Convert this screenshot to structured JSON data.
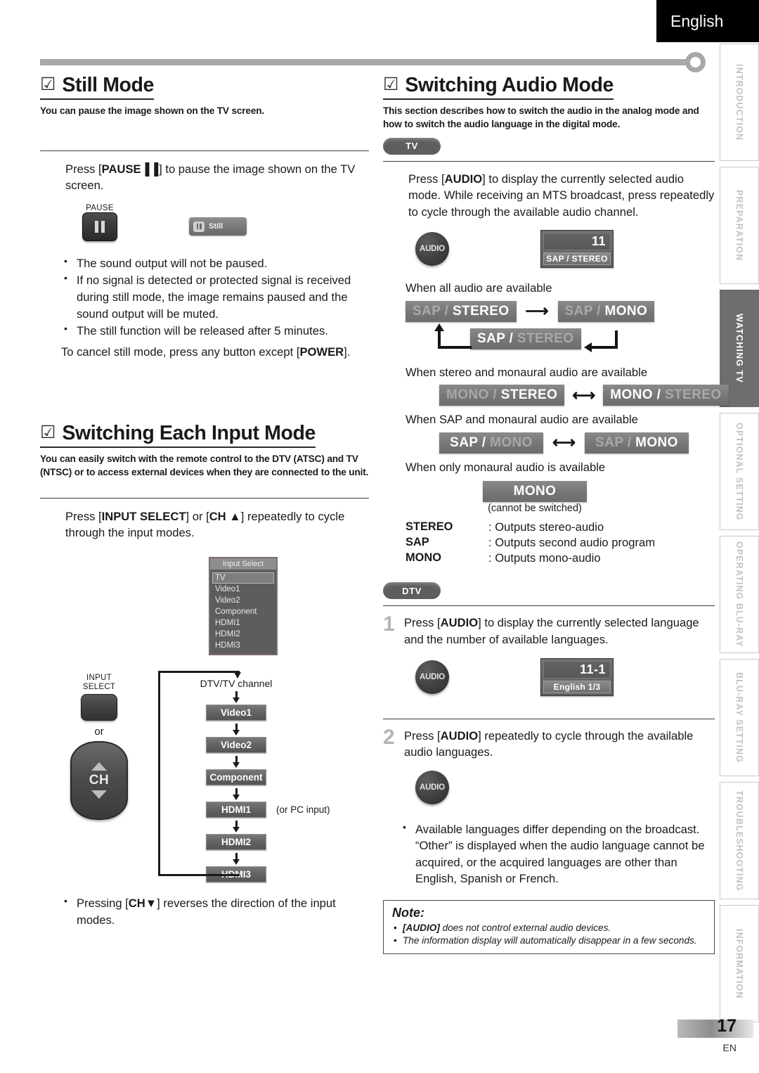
{
  "header": {
    "language": "English"
  },
  "side_tabs": [
    {
      "label": "INTRODUCTION",
      "active": false
    },
    {
      "label": "PREPARATION",
      "active": false
    },
    {
      "label": "WATCHING TV",
      "active": true
    },
    {
      "label": "OPTIONAL SETTING",
      "active": false
    },
    {
      "label": "OPERATING BLU-RAY",
      "active": false
    },
    {
      "label": "BLU-RAY SETTING",
      "active": false
    },
    {
      "label": "TROUBLESHOOTING",
      "active": false
    },
    {
      "label": "INFORMATION",
      "active": false
    }
  ],
  "still_mode": {
    "check": "☑",
    "heading": "Still Mode",
    "subtitle": "You can pause the image shown on the TV screen.",
    "instruction_pre": "Press [",
    "instruction_key": "PAUSE",
    "instruction_post": "] to pause the image shown on the TV screen.",
    "pause_caption": "PAUSE",
    "osd_still_label": "Still",
    "bullets": [
      "The sound output will not be paused.",
      "If no signal is detected or protected signal is received during still mode, the image remains paused and the sound output will be muted.",
      "The still function will be released after 5 minutes."
    ],
    "cancel_pre": "To cancel still mode, press any button except [",
    "cancel_key": "POWER",
    "cancel_post": "]."
  },
  "input_mode": {
    "check": "☑",
    "heading": "Switching Each Input Mode",
    "subtitle": "You can easily switch with the remote control to the DTV (ATSC) and TV (NTSC) or to access external devices when they are connected to the unit.",
    "instruction_pre": "Press [",
    "instruction_key1": "INPUT SELECT",
    "instruction_mid": "] or [",
    "instruction_key2": "CH ▲",
    "instruction_post": "] repeatedly to cycle through the input modes.",
    "osd": {
      "title": "Input Select",
      "items": [
        "TV",
        "Video1",
        "Video2",
        "Component",
        "HDMI1",
        "HDMI2",
        "HDMI3"
      ],
      "selected": "TV"
    },
    "remote": {
      "input_select_line1": "INPUT",
      "input_select_line2": "SELECT",
      "or": "or",
      "ch_label": "CH"
    },
    "flow": {
      "first": "DTV/TV channel",
      "items": [
        "Video1",
        "Video2",
        "Component",
        "HDMI1",
        "HDMI2",
        "HDMI3"
      ],
      "hdmi1_note": "(or PC input)"
    },
    "bullet_pre": "Pressing [",
    "bullet_key": "CH▼",
    "bullet_post": "] reverses the direction of the input modes."
  },
  "audio_mode": {
    "check": "☑",
    "heading": "Switching Audio Mode",
    "subtitle": "This section describes how to switch the audio in the analog mode and how to switch the audio language in the digital mode.",
    "tv_badge": "TV",
    "dtv_badge": "DTV",
    "tv_instruction_pre": "Press [",
    "tv_instruction_key": "AUDIO",
    "tv_instruction_post": "] to display the currently selected audio mode. While receiving an MTS broadcast, press repeatedly to cycle through the available audio channel.",
    "audio_key_label": "AUDIO",
    "osd_tv": {
      "channel": "11",
      "mode": "SAP / STEREO"
    },
    "case1_label": "When all audio are available",
    "case1_boxes": [
      {
        "left": "SAP",
        "sep": " / ",
        "right": "STEREO",
        "emphasis": "right"
      },
      {
        "left": "SAP",
        "sep": " / ",
        "right": "MONO",
        "emphasis": "right"
      },
      {
        "left": "SAP",
        "sep": " / ",
        "right": "STEREO",
        "emphasis": "left"
      }
    ],
    "case2_label": "When stereo and monaural audio are available",
    "case2_boxes": [
      {
        "left": "MONO",
        "sep": " / ",
        "right": "STEREO",
        "emphasis": "right"
      },
      {
        "left": "MONO",
        "sep": " / ",
        "right": "STEREO",
        "emphasis": "left"
      }
    ],
    "case3_label": "When SAP and monaural audio are available",
    "case3_boxes": [
      {
        "left": "SAP",
        "sep": " / ",
        "right": "MONO",
        "emphasis": "left"
      },
      {
        "left": "SAP",
        "sep": " / ",
        "right": "MONO",
        "emphasis": "right"
      }
    ],
    "case4_label": "When only monaural audio is available",
    "case4_box": "MONO",
    "case4_note": "(cannot be switched)",
    "legend": [
      {
        "key": "STEREO",
        "value": ": Outputs stereo-audio"
      },
      {
        "key": "SAP",
        "value": ": Outputs second audio program"
      },
      {
        "key": "MONO",
        "value": ": Outputs mono-audio"
      }
    ],
    "step1": {
      "number": "1",
      "pre": "Press [",
      "key": "AUDIO",
      "post": "] to display the currently selected language and the number of available languages.",
      "osd": {
        "channel": "11-1",
        "mode": "English 1/3"
      }
    },
    "step2": {
      "number": "2",
      "pre": "Press [",
      "key": "AUDIO",
      "post": "] repeatedly to cycle through the available audio languages."
    },
    "bullet": "Available languages differ depending on the broadcast. “Other” is displayed when the audio language cannot be acquired, or the acquired languages are other than English, Spanish or French.",
    "note": {
      "title": "Note:",
      "items": [
        {
          "key": "[AUDIO]",
          "rest": " does not control external audio devices."
        },
        {
          "key": "",
          "rest": "The information display will automatically disappear in a few seconds."
        }
      ]
    }
  },
  "footer": {
    "page": "17",
    "lang_code": "EN"
  }
}
